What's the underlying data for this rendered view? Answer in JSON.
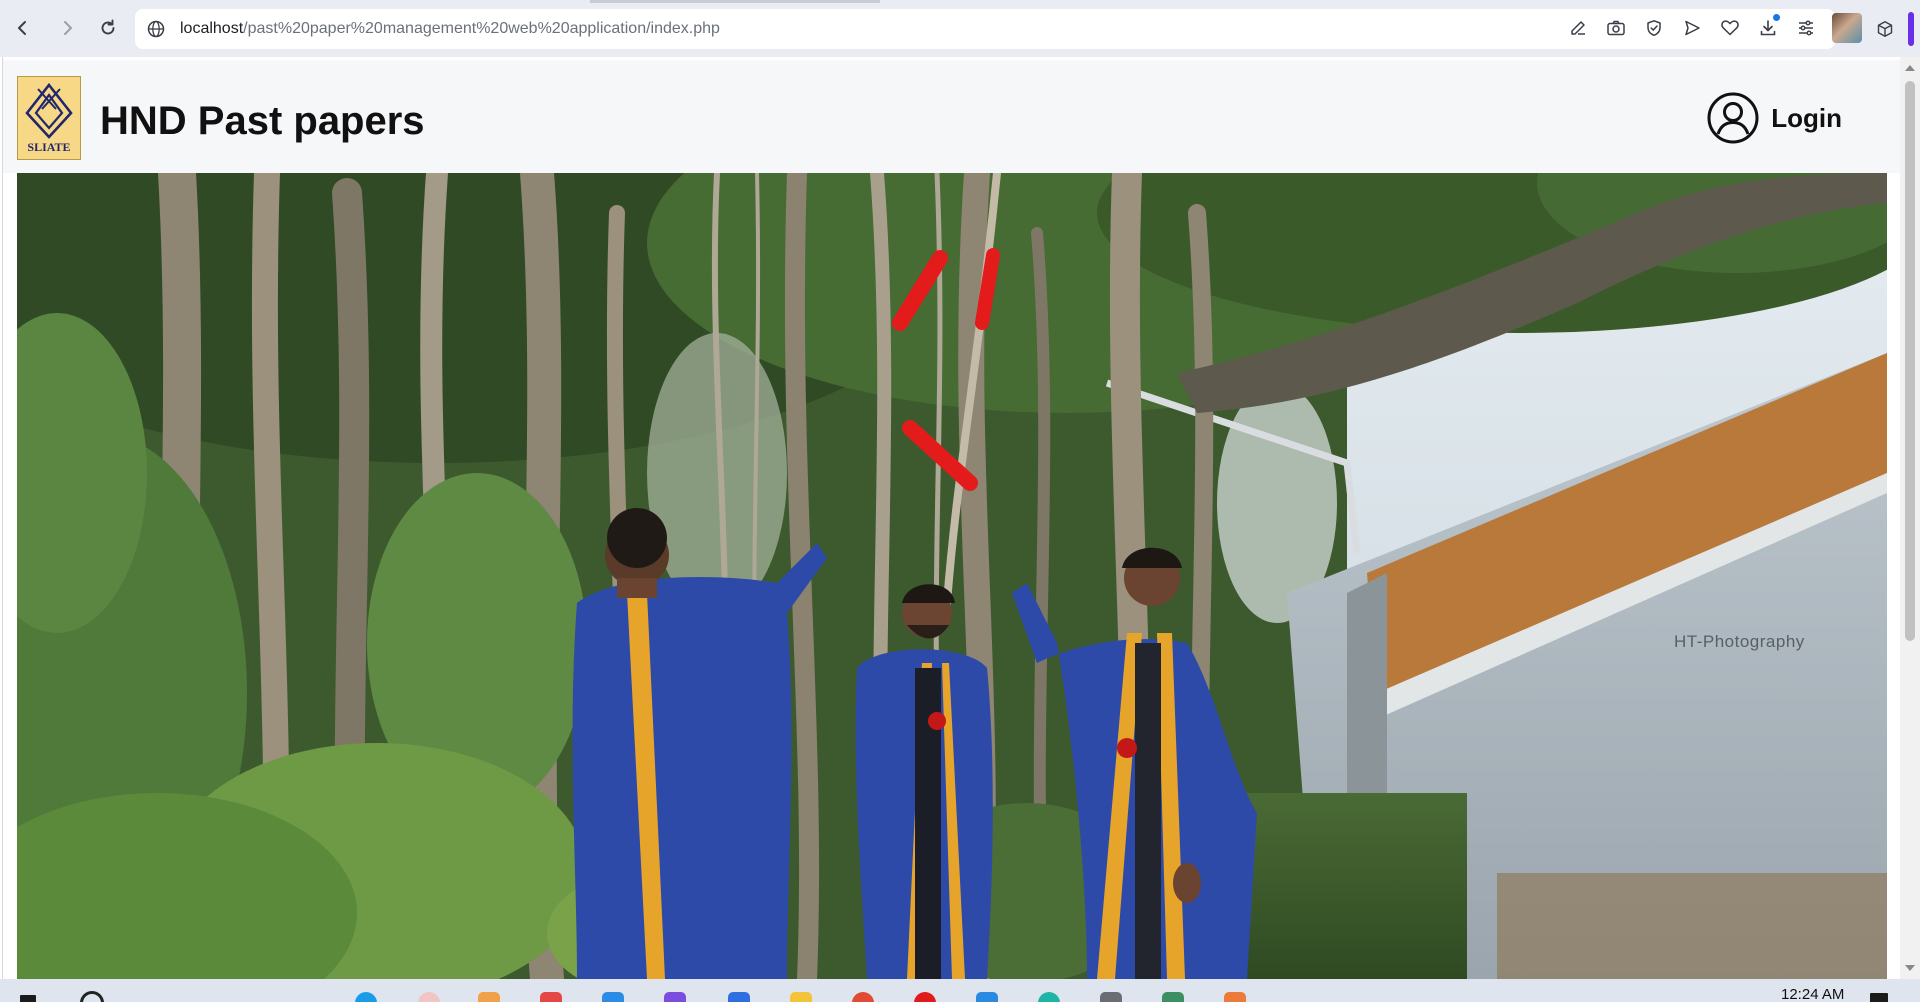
{
  "browser": {
    "url_host": "localhost",
    "url_path": "/past%20paper%20management%20web%20application/index.php",
    "toolbar_icons": [
      "edit-icon",
      "camera-icon",
      "shield-check-icon",
      "send-icon",
      "heart-icon",
      "download-icon",
      "menu-icon",
      "profile-avatar",
      "extensions-icon"
    ]
  },
  "site": {
    "logo_text": "SLIATE",
    "title": "HND Past papers",
    "login_label": "Login"
  },
  "hero": {
    "watermark": "HT-Photography"
  },
  "taskbar": {
    "clock": "12:24 AM"
  },
  "colors": {
    "robe_blue": "#2e4aa8",
    "stole_gold": "#e6a52a",
    "scroll_red": "#e41b1b",
    "foliage": "#4f7a3a"
  }
}
